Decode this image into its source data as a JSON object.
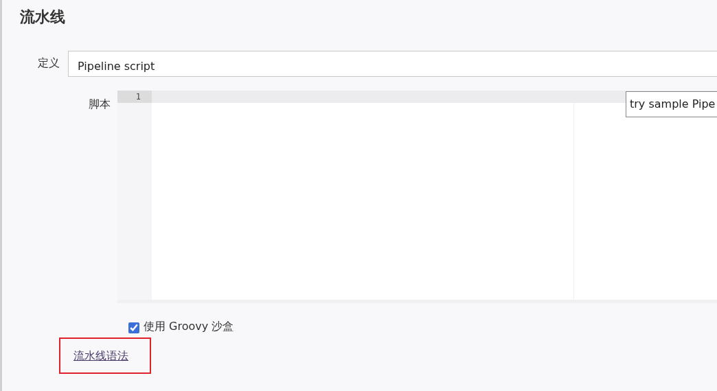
{
  "section_title": "流水线",
  "definition": {
    "label": "定义",
    "value": "Pipeline script"
  },
  "script": {
    "label": "脚本",
    "line_numbers": [
      "1"
    ],
    "sample_select": "try sample Pipe"
  },
  "sandbox": {
    "label": "使用 Groovy 沙盒",
    "checked": true
  },
  "syntax_link": {
    "label": "流水线语法",
    "highlighted": true
  }
}
